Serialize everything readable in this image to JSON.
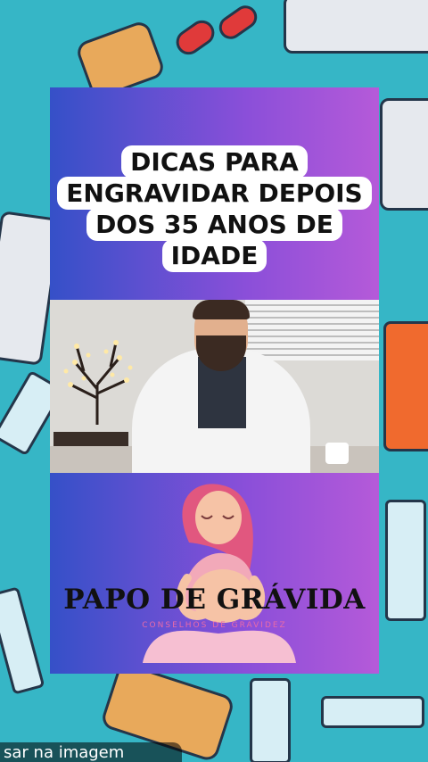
{
  "title_lines": [
    "DICAS PARA",
    "ENGRAVIDAR DEPOIS",
    "DOS 35 ANOS DE",
    "IDADE"
  ],
  "brand": {
    "name": "PAPO DE GRÁVIDA",
    "tagline": "CONSELHOS DE GRAVIDEZ"
  },
  "caption": "sar na imagem",
  "icons": {
    "background": "medical-pattern",
    "video_subject": "doctor-in-white-coat",
    "logo": "pregnant-woman-meditating"
  },
  "colors": {
    "background": "#36b6c6",
    "panel_left": "#3550c8",
    "panel_right": "#b55ad9",
    "title_box": "#ffffff"
  }
}
